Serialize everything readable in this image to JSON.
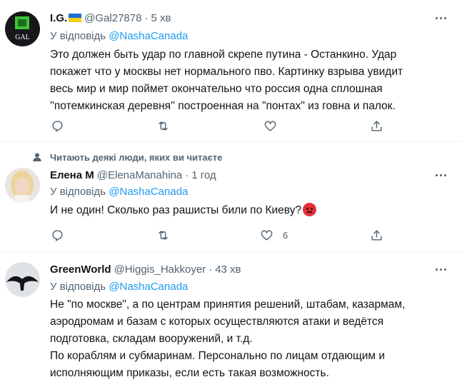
{
  "tweets": [
    {
      "name": "I.G.",
      "flag": "ukraine-flag",
      "handle": "@Gal27878",
      "time": "5 хв",
      "reply_prefix": "У відповідь",
      "reply_mention": "@NashaCanada",
      "avatar_text": "GAL",
      "lines": [
        "Это должен быть удар по главной скрепе путина - Останкино. Удар",
        "покажет что у москвы нет нормального пво. Картинку взрыва увидит",
        "весь мир и мир поймет окончательно что россия одна сплошная",
        "''потемкинская деревня'' построенная на \"понтах\" из говна и палок."
      ],
      "like_count": ""
    },
    {
      "social_context": "Читають деякі люди, яких ви читаєте",
      "name": "Елена М",
      "handle": "@ElenaManahina",
      "time": "1 год",
      "reply_prefix": "У відповідь",
      "reply_mention": "@NashaCanada",
      "lines": [
        "И не один! Сколько раз рашисты били по Киеву?"
      ],
      "emoji": "angry-face",
      "like_count": "6"
    },
    {
      "name": "GreenWorld",
      "handle": "@Higgis_Hakkoyer",
      "time": "43 хв",
      "reply_prefix": "У відповідь",
      "reply_mention": "@NashaCanada",
      "lines": [
        "Не \"по москве\", а по центрам принятия решений, штабам, казармам,",
        "аэродромам и базам с которых осуществляются атаки и ведётся",
        "подготовка, складам вооружений, и т.д.",
        "По кораблям и субмаринам. Персонально по лицам отдающим и",
        "исполняющим приказы, если есть такая возможность."
      ]
    }
  ],
  "dot_separator": "·",
  "colors": {
    "text": "#0f1419",
    "secondary": "#536471",
    "link": "#1d9bf0",
    "divider": "#eff3f4"
  },
  "icons": [
    "reply-icon",
    "retweet-icon",
    "like-icon",
    "share-icon",
    "more-icon",
    "person-icon"
  ]
}
